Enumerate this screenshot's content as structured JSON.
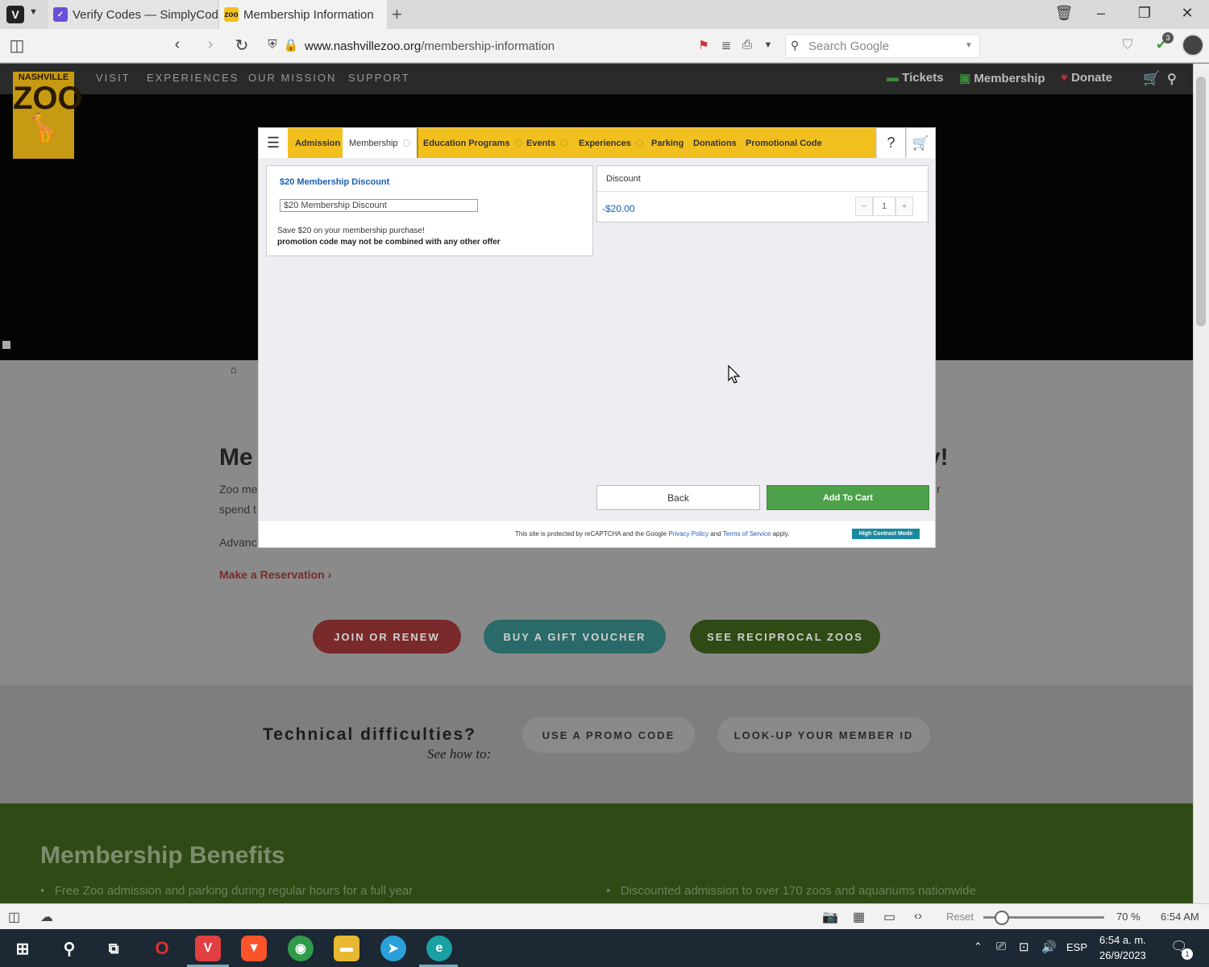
{
  "browser": {
    "tabs": [
      {
        "title": "Verify Codes — SimplyCodes"
      },
      {
        "title": "Membership Information"
      }
    ],
    "new_tab": "+",
    "url_domain": "www.nashvillezoo.org",
    "url_path": "/membership-information",
    "search_placeholder": "Search Google",
    "extension_badge": "3"
  },
  "site": {
    "logo_text": "ZOO",
    "logo_top": "NASHVILLE",
    "nav": [
      "VISIT",
      "EXPERIENCES",
      "OUR MISSION",
      "SUPPORT"
    ],
    "header_links": {
      "tickets": "Tickets",
      "membership": "Membership",
      "donate": "Donate"
    },
    "heading_left": "Me",
    "heading_right": "y!",
    "para1": "Zoo me",
    "para2": "spend t",
    "para3": "Advanc",
    "para_r": "r",
    "reservation_link": "Make a Reservation ›",
    "pills": [
      "JOIN OR RENEW",
      "BUY A GIFT VOUCHER",
      "SEE RECIPROCAL ZOOS"
    ],
    "tech_heading": "Technical difficulties?",
    "tech_sub": "See how to:",
    "tech_buttons": [
      "USE A PROMO CODE",
      "LOOK-UP YOUR MEMBER ID"
    ],
    "benefits_heading": "Membership Benefits",
    "benefits": [
      "Free Zoo admission and parking during regular hours for a full year",
      "Discounted admission to over 170 zoos and aquariums nationwide"
    ]
  },
  "modal": {
    "menu_label": "MENU",
    "tabs": [
      "Admission",
      "Membership",
      "Education Programs",
      "Events",
      "Experiences",
      "Parking",
      "Donations",
      "Promotional Code"
    ],
    "item": {
      "title": "$20 Membership Discount",
      "image_alt": "$20 Membership Discount",
      "desc1": "Save $20 on your membership purchase!",
      "desc2": "promotion code may not be combined with any other offer"
    },
    "discount": {
      "header": "Discount",
      "amount": "-$20.00",
      "quantity": "1"
    },
    "back_label": "Back",
    "add_label": "Add To Cart",
    "footer": {
      "text1": "This site is protected by reCAPTCHA and the Google",
      "privacy": "Privacy Policy",
      "and": "and",
      "terms": "Terms of Service",
      "apply": "apply.",
      "contrast_button": "High Contrast Mode"
    }
  },
  "statusbar": {
    "reset": "Reset",
    "zoom_percent": 70,
    "zoom_label": "70 %",
    "time": "6:54 AM"
  },
  "taskbar": {
    "lang": "ESP",
    "time": "6:54 a. m.",
    "date": "26/9/2023",
    "notifications": "1"
  },
  "colors": {
    "modal_nav": "#f2c01e",
    "add_to_cart": "#4ca14a",
    "link_blue": "#1a60b4"
  }
}
